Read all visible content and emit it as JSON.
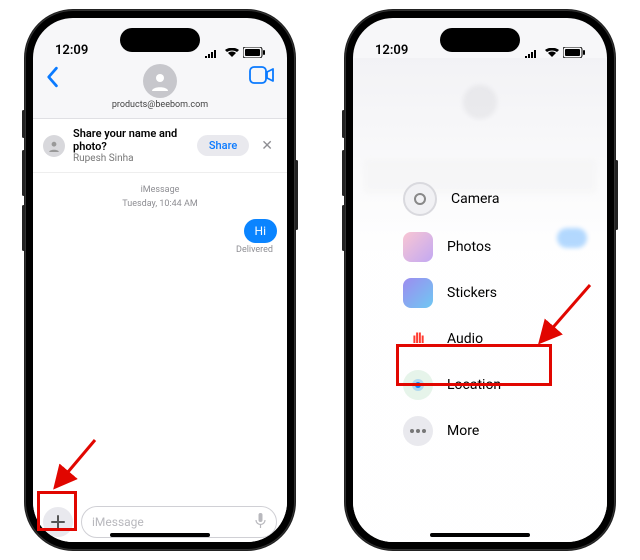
{
  "status": {
    "time": "12:09"
  },
  "contact": {
    "name": "products@beebom.com"
  },
  "share_prompt": {
    "title": "Share your name and photo?",
    "subtitle": "Rupesh Sinha",
    "button": "Share"
  },
  "thread": {
    "meta_service": "iMessage",
    "meta_time": "Tuesday, 10:44 AM",
    "bubble": "Hi",
    "status": "Delivered"
  },
  "composer": {
    "placeholder": "iMessage"
  },
  "menu": {
    "items": [
      {
        "label": "Camera"
      },
      {
        "label": "Photos"
      },
      {
        "label": "Stickers"
      },
      {
        "label": "Audio"
      },
      {
        "label": "Location"
      },
      {
        "label": "More"
      }
    ]
  }
}
